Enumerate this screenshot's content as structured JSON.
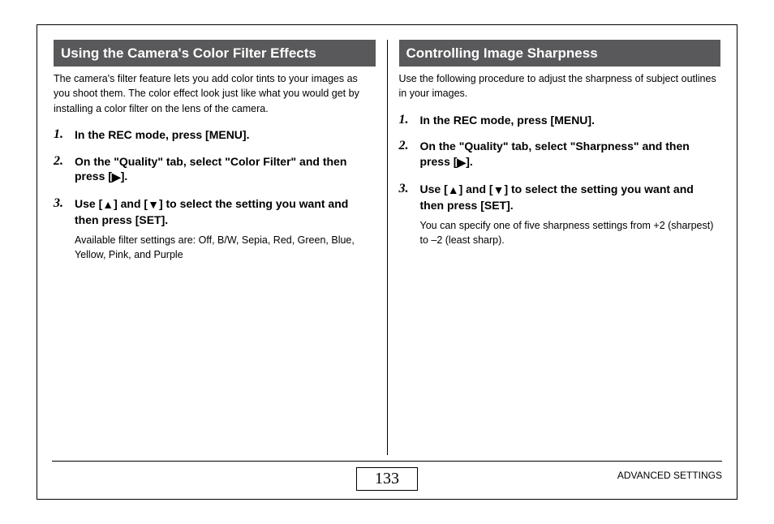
{
  "left": {
    "heading": "Using the Camera's Color Filter Effects",
    "intro": "The camera's filter feature lets you add color tints to your images as you shoot them. The color effect look just like what you would get by installing a color filter on the lens of the camera.",
    "steps": [
      {
        "text": "In the REC mode, press [MENU]."
      },
      {
        "text_pre": "On the \"Quality\" tab, select \"Color Filter\" and then press [",
        "icon": "right",
        "text_post": "]."
      },
      {
        "text_pre": "Use [",
        "icon1": "up",
        "mid": "] and [",
        "icon2": "down",
        "text_post": "] to select the setting you want and then press [SET].",
        "sub": "Available filter settings are: Off, B/W, Sepia, Red, Green, Blue, Yellow, Pink, and Purple"
      }
    ]
  },
  "right": {
    "heading": "Controlling Image Sharpness",
    "intro": "Use the following procedure to adjust the sharpness of subject outlines in your images.",
    "steps": [
      {
        "text": "In the REC mode, press [MENU]."
      },
      {
        "text_pre": "On the \"Quality\" tab, select \"Sharpness\" and then press [",
        "icon": "right",
        "text_post": "]."
      },
      {
        "text_pre": "Use [",
        "icon1": "up",
        "mid": "] and [",
        "icon2": "down",
        "text_post": "] to select the setting you want and then press [SET].",
        "sub": "You can specify one of five sharpness settings from +2 (sharpest) to –2 (least sharp)."
      }
    ]
  },
  "footer": {
    "page": "133",
    "section": "ADVANCED SETTINGS"
  }
}
